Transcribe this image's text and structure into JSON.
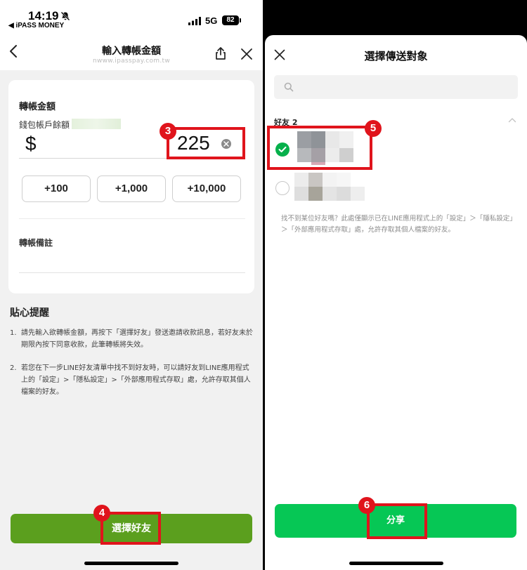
{
  "left": {
    "status_bar": {
      "time": "14:19",
      "back_app": "◀ iPASS MONEY",
      "network": "5G",
      "battery": "82"
    },
    "nav": {
      "title": "輸入轉帳金額",
      "url": "nwww.ipasspay.com.tw"
    },
    "form": {
      "amount_label": "轉帳金額",
      "balance_label": "錢包帳戶餘額",
      "currency": "$",
      "amount_value": "225",
      "quick_buttons": [
        "+100",
        "+1,000",
        "+10,000"
      ],
      "memo_label": "轉帳備註"
    },
    "tips": {
      "title": "貼心提醒",
      "items": [
        {
          "num": "1.",
          "text": "請先輸入欲轉帳金額，再按下「選擇好友」發送邀請收款訊息，若好友未於期限內按下同意收款，此筆轉帳將失效。"
        },
        {
          "num": "2.",
          "text": "若您在下一步LINE好友清單中找不到好友時，可以請好友到LINE應用程式上的「設定」>「隱私設定」>「外部應用程式存取」處，允許存取其個人檔案的好友。"
        }
      ]
    },
    "primary_button": "選擇好友"
  },
  "right": {
    "title": "選擇傳送對象",
    "search_placeholder": "",
    "group_label": "好友 2",
    "note": "找不到某位好友嗎？此處僅顯示已在LINE應用程式上的「設定」＞「隱私設定」＞「外部應用程式存取」處，允許存取其個人檔案的好友。",
    "share_button": "分享"
  },
  "annotations": {
    "step_amount": "3",
    "step_choose": "4",
    "step_friend": "5",
    "step_share": "6"
  },
  "colors": {
    "primary_green": "#5b9f1e",
    "line_green": "#06c755",
    "highlight_red": "#e0141c"
  }
}
